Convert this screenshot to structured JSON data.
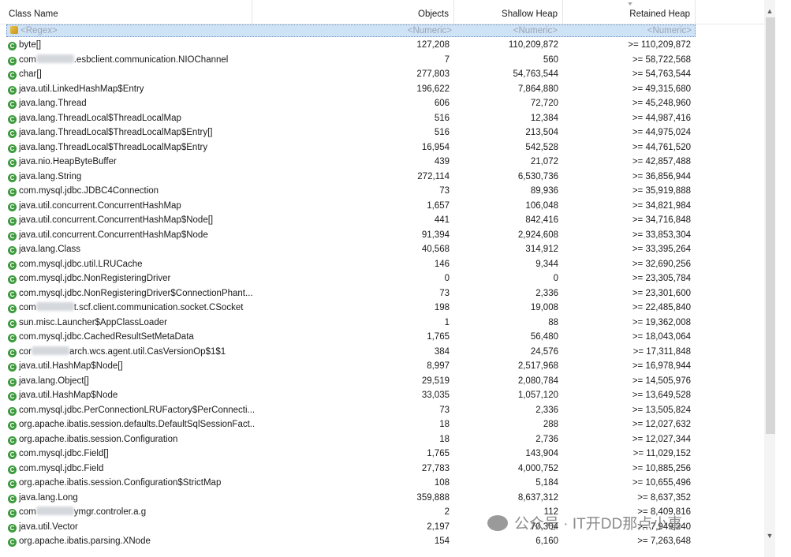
{
  "columns": {
    "name": "Class Name",
    "objects": "Objects",
    "shallow": "Shallow Heap",
    "retained": "Retained Heap"
  },
  "filter": {
    "name": "<Regex>",
    "objects": "<Numeric>",
    "shallow": "<Numeric>",
    "retained": "<Numeric>"
  },
  "rows": [
    {
      "pre": "byte[]",
      "post": "",
      "objects": "127,208",
      "shallow": "110,209,872",
      "retained": ">= 110,209,872"
    },
    {
      "pre": "com",
      "post": ".esbclient.communication.NIOChannel",
      "redacted": true,
      "objects": "7",
      "shallow": "560",
      "retained": ">= 58,722,568"
    },
    {
      "pre": "char[]",
      "post": "",
      "objects": "277,803",
      "shallow": "54,763,544",
      "retained": ">= 54,763,544"
    },
    {
      "pre": "java.util.LinkedHashMap$Entry",
      "post": "",
      "objects": "196,622",
      "shallow": "7,864,880",
      "retained": ">= 49,315,680"
    },
    {
      "pre": "java.lang.Thread",
      "post": "",
      "objects": "606",
      "shallow": "72,720",
      "retained": ">= 45,248,960"
    },
    {
      "pre": "java.lang.ThreadLocal$ThreadLocalMap",
      "post": "",
      "objects": "516",
      "shallow": "12,384",
      "retained": ">= 44,987,416"
    },
    {
      "pre": "java.lang.ThreadLocal$ThreadLocalMap$Entry[]",
      "post": "",
      "objects": "516",
      "shallow": "213,504",
      "retained": ">= 44,975,024"
    },
    {
      "pre": "java.lang.ThreadLocal$ThreadLocalMap$Entry",
      "post": "",
      "objects": "16,954",
      "shallow": "542,528",
      "retained": ">= 44,761,520"
    },
    {
      "pre": "java.nio.HeapByteBuffer",
      "post": "",
      "objects": "439",
      "shallow": "21,072",
      "retained": ">= 42,857,488"
    },
    {
      "pre": "java.lang.String",
      "post": "",
      "objects": "272,114",
      "shallow": "6,530,736",
      "retained": ">= 36,856,944"
    },
    {
      "pre": "com.mysql.jdbc.JDBC4Connection",
      "post": "",
      "objects": "73",
      "shallow": "89,936",
      "retained": ">= 35,919,888"
    },
    {
      "pre": "java.util.concurrent.ConcurrentHashMap",
      "post": "",
      "objects": "1,657",
      "shallow": "106,048",
      "retained": ">= 34,821,984"
    },
    {
      "pre": "java.util.concurrent.ConcurrentHashMap$Node[]",
      "post": "",
      "objects": "441",
      "shallow": "842,416",
      "retained": ">= 34,716,848"
    },
    {
      "pre": "java.util.concurrent.ConcurrentHashMap$Node",
      "post": "",
      "objects": "91,394",
      "shallow": "2,924,608",
      "retained": ">= 33,853,304"
    },
    {
      "pre": "java.lang.Class",
      "post": "",
      "objects": "40,568",
      "shallow": "314,912",
      "retained": ">= 33,395,264"
    },
    {
      "pre": "com.mysql.jdbc.util.LRUCache",
      "post": "",
      "objects": "146",
      "shallow": "9,344",
      "retained": ">= 32,690,256"
    },
    {
      "pre": "com.mysql.jdbc.NonRegisteringDriver",
      "post": "",
      "objects": "0",
      "shallow": "0",
      "retained": ">= 23,305,784"
    },
    {
      "pre": "com.mysql.jdbc.NonRegisteringDriver$ConnectionPhant...",
      "post": "",
      "objects": "73",
      "shallow": "2,336",
      "retained": ">= 23,301,600"
    },
    {
      "pre": "com",
      "post": "t.scf.client.communication.socket.CSocket",
      "redacted": true,
      "objects": "198",
      "shallow": "19,008",
      "retained": ">= 22,485,840"
    },
    {
      "pre": "sun.misc.Launcher$AppClassLoader",
      "post": "",
      "objects": "1",
      "shallow": "88",
      "retained": ">= 19,362,008"
    },
    {
      "pre": "com.mysql.jdbc.CachedResultSetMetaData",
      "post": "",
      "objects": "1,765",
      "shallow": "56,480",
      "retained": ">= 18,043,064"
    },
    {
      "pre": "cor",
      "post": "arch.wcs.agent.util.CasVersionOp$1$1",
      "redacted": true,
      "objects": "384",
      "shallow": "24,576",
      "retained": ">= 17,311,848"
    },
    {
      "pre": "java.util.HashMap$Node[]",
      "post": "",
      "objects": "8,997",
      "shallow": "2,517,968",
      "retained": ">= 16,978,944"
    },
    {
      "pre": "java.lang.Object[]",
      "post": "",
      "objects": "29,519",
      "shallow": "2,080,784",
      "retained": ">= 14,505,976"
    },
    {
      "pre": "java.util.HashMap$Node",
      "post": "",
      "objects": "33,035",
      "shallow": "1,057,120",
      "retained": ">= 13,649,528"
    },
    {
      "pre": "com.mysql.jdbc.PerConnectionLRUFactory$PerConnecti...",
      "post": "",
      "objects": "73",
      "shallow": "2,336",
      "retained": ">= 13,505,824"
    },
    {
      "pre": "org.apache.ibatis.session.defaults.DefaultSqlSessionFact...",
      "post": "",
      "objects": "18",
      "shallow": "288",
      "retained": ">= 12,027,632"
    },
    {
      "pre": "org.apache.ibatis.session.Configuration",
      "post": "",
      "objects": "18",
      "shallow": "2,736",
      "retained": ">= 12,027,344"
    },
    {
      "pre": "com.mysql.jdbc.Field[]",
      "post": "",
      "objects": "1,765",
      "shallow": "143,904",
      "retained": ">= 11,029,152"
    },
    {
      "pre": "com.mysql.jdbc.Field",
      "post": "",
      "objects": "27,783",
      "shallow": "4,000,752",
      "retained": ">= 10,885,256"
    },
    {
      "pre": "org.apache.ibatis.session.Configuration$StrictMap",
      "post": "",
      "objects": "108",
      "shallow": "5,184",
      "retained": ">= 10,655,496"
    },
    {
      "pre": "java.lang.Long",
      "post": "",
      "objects": "359,888",
      "shallow": "8,637,312",
      "retained": ">= 8,637,352"
    },
    {
      "pre": "com",
      "post": "ymgr.controler.a.g",
      "redacted": true,
      "objects": "2",
      "shallow": "112",
      "retained": ">= 8,409,816"
    },
    {
      "pre": "java.util.Vector",
      "post": "",
      "objects": "2,197",
      "shallow": "70,304",
      "retained": ">= 7,949,240"
    },
    {
      "pre": "org.apache.ibatis.parsing.XNode",
      "post": "",
      "objects": "154",
      "shallow": "6,160",
      "retained": ">= 7,263,648"
    }
  ],
  "watermark": "公众号 · IT开DD那点小事",
  "scroll": {
    "up": "▲",
    "down": "▼"
  }
}
